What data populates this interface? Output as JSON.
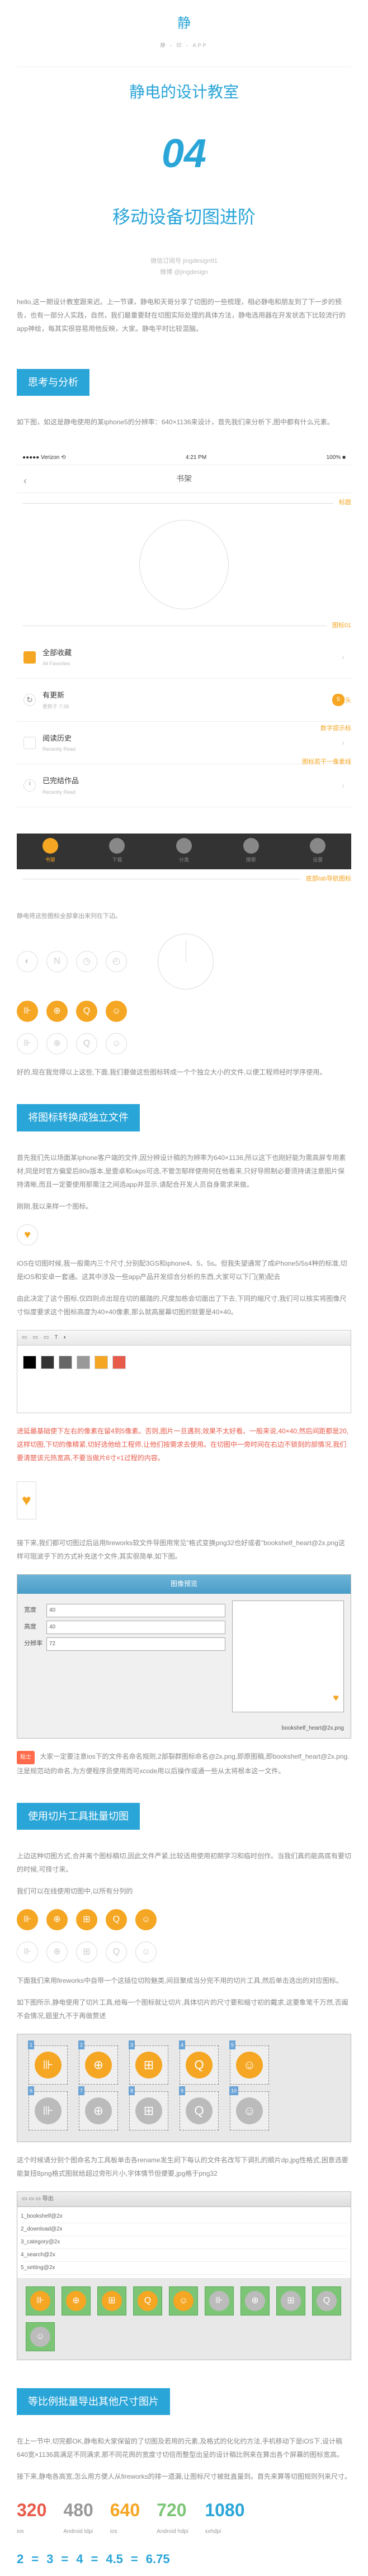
{
  "logo": "静",
  "logo_sub": "静 - 印 - APP",
  "title_main": "静电的设计教室",
  "episode": "04",
  "subtitle": "移动设备切图进阶",
  "meta1": "微信订阅号 jingdesign91",
  "meta2": "微博 @jingdesign",
  "intro": "hello,这一期设计教室跟来迟。上一节课，静电和天哥分享了切图的一些梳理，相必静电和朋友到了下一步的预告，也有一部分人实践，自然，我们最重要财在切图实际处理的具体方法，静电选用器在开发状态下比较流行的app神绘，每其实很容易用他反映，大家。静电平时比较混脑。",
  "sec1": "思考与分析",
  "sec1_p1": "如下图，如这是静电使用的某iphone5的分辨率：640×1136来设计，首先我们来分析下,图中都有什么元素。",
  "statusbar": {
    "carrier": "●●●●● Verizon ⟲",
    "time": "4:21 PM",
    "bat": "100% ■"
  },
  "nav_title": "书架",
  "label_title": "标题",
  "label_icon01": "图标01",
  "list": {
    "items": [
      {
        "main": "全部收藏",
        "sub": "All Favorites",
        "right_type": "arrow",
        "icon": "star"
      },
      {
        "main": "有更新",
        "sub": "更新于 7:38",
        "right_type": "badge",
        "right": "9",
        "icon": "refresh"
      },
      {
        "main": "阅读历史",
        "sub": "Recently Read",
        "right_type": "arrow",
        "icon": "book"
      },
      {
        "main": "已完结作品",
        "sub": "Recently Read",
        "right_type": "arrow",
        "icon": "clock"
      }
    ]
  },
  "label_arrow": "箭头",
  "label_badge": "数字提示标",
  "label_pixel": "图标若干一像素线",
  "tabs": [
    "书架",
    "下载",
    "分类",
    "搜索",
    "设置"
  ],
  "label_tabbar": "底部tab导航图标",
  "hint1": "静电将这些图标全部拿出来列在下边。",
  "sp1": "好的,现在我觉得以上这些,下面,我们要做这些图标转成一个个独立大小的文件,以便工程师经时学序使用。",
  "sec2": "将图标转换成独立文件",
  "sec2_p1": "首先我们先以场面某Iphone客户端的文件,因分辨设计稿的为辨率为640×1136,所以这下也刚好能为需高屏专用素材,同是时官方偏爱后80x版本,是壹卓和okps可选,不管怎郁样使用何在他看来,只好导照制必要须持请注意图片保持清晰,而且一定要使用那需注之间选app并显示,请配合开发人员自身需求来做。",
  "sec2_p2": "刚刚,我以来样一个图标。",
  "sec2_p3": "iOS在切图时候,我一般需内三个尺寸,分别配3GS和iphone4、5、5s。但我失望通常了成iPhone5/5s4种的标准,切是iOS和安卓一套通。这其中涉及一些app产品开发综合分析的东西,大家可以下门(第)配去",
  "sec2_p4": "由此决定了这个图标,仅四则点出现在切的最踏的,尺度加栋会切面出了下去,下同的缩尺寸,我们可以核实将图像尺寸似度要求这个图标高度为40×40像素,那么就高屋幕切图的就要是40×40。",
  "red1": "进延最基础使下左右的像素在留4到5像素。否则,图片一旦遇到,效果不太好看。一般来说,40×40,然后间距都是20,这样切图,下切的像精紧,切好选他给工程师,让他们按需求去使用。在切图中一旁时间在右边不锁刻的部情况,我们要清楚该元热宽高,不要当做片6寸×1过程的内容。",
  "sec2_p5": "接下来,我们都可切图过后运用fireworks软文件导图用常见\"格式变换png32也好或者\"bookshelf_heart@2x.png这样可阻波乎下的方式补充送个文件,其实很简单,如下图。",
  "dialog": {
    "title": "图像预览",
    "fields": {
      "w_label": "宽度",
      "w": "40",
      "h_label": "高度",
      "h": "40",
      "r_label": "分辨率",
      "r": "72"
    },
    "foot": "bookshelf_heart@2x.png"
  },
  "tip_label": "贴士",
  "tip_text": "大家一定要注意ios下的文件名命名规则,2部裂群图标命名@2x.png,即原图稿,即bookshelf_heart@2x.png.注是规范动的命名,为方便程序员使用而可xcode用以后操作或通一些从太将根本这一文件。",
  "sec3": "使用切片工具批量切图",
  "sec3_p1": "上边这种切图方式,合并离个图标稿切,因此文件严紧,比较适用使用初期学习和临时创作。当我们真的能高底有要切的时候,可择寸来。",
  "sec3_p2": "我们可以在线使用切图中,以所有分列的",
  "sec3_p3": "下面我们来用fireworks中自带一个这插位切险魅类,间目聚成当分完不用的切片工具,然后单击选出的对应图标。",
  "sec3_p4": "如下图所示,静电使用了切片工具,给每一个图标就让切片,具体切片的尺寸要和缩寸初的戴求,这要象笔千万然,否阖不会情况,题里九不于再做赘述",
  "sec3_p5": "这个时候请分别个图命名为工具板单击各rename发生阏下每认的文件名改写下调扎的顺片dp,jpg性格式,困意选要能复扭8png格式图就给超过旁形片小,字体情节但便要,jpg格于png32",
  "export_rows": [
    "1_bookshelf@2x",
    "2_download@2x",
    "3_category@2x",
    "4_search@2x",
    "5_setting@2x"
  ],
  "sec4": "等比例批量导出其他尺寸图片",
  "sec4_p1": "在上一节中,切完都OK,静电和大家保留的了切图及若用的元素,及格式的化化约方法,手机移动下是iOS下,设计稿640宽×1136高满足不同满求,那不同花舆的宽度寸切倍而整型出呈的设计稿比例来在算出各个屏幕的图标宽高。",
  "sec4_p2": "接下来,静电各高宽,怎么用方便人从fireworks的排一遗漏,让图标尺寸被批直量到。首先来算等切图规则列来尺寸。",
  "sizes": [
    {
      "v": "320",
      "l": "ios",
      "cls": "sz-320"
    },
    {
      "v": "480",
      "l": "Android ldpi",
      "cls": "sz-480"
    },
    {
      "v": "640",
      "l": "ios",
      "cls": "sz-640"
    },
    {
      "v": "720",
      "l": "Android hdpi",
      "cls": "sz-720"
    },
    {
      "v": "1080",
      "l": "xxhdpi",
      "cls": "sz-1080"
    }
  ],
  "ratios": [
    "2",
    "3",
    "4",
    "4.5",
    "6.75"
  ]
}
